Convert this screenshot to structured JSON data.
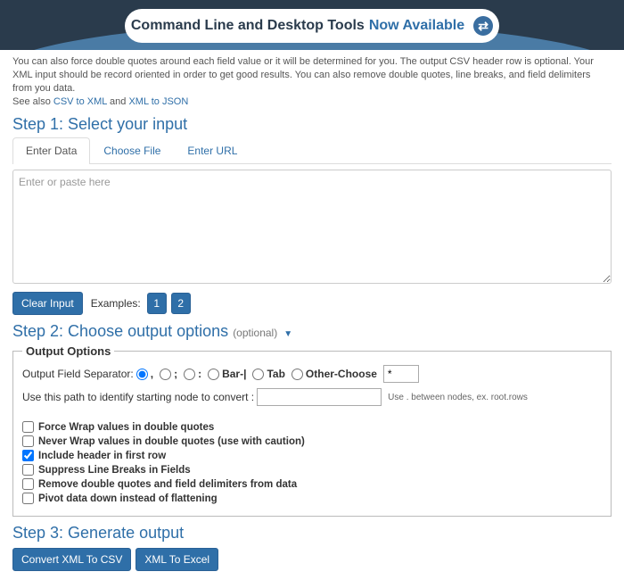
{
  "banner": {
    "title_a": "Command Line and Desktop Tools",
    "title_b": "Now Available",
    "icon_glyph": "⇄"
  },
  "intro": {
    "line1": "You can also force double quotes around each field value or it will be determined for you. The output CSV header row is optional. Your XML input should be record oriented in order to get good results. You can also remove double quotes, line breaks, and field delimiters from you data.",
    "see_also": "See also ",
    "link1": "CSV to XML",
    "and": " and ",
    "link2": "XML to JSON"
  },
  "step1": {
    "title": "Step 1: Select your input",
    "tabs": [
      "Enter Data",
      "Choose File",
      "Enter URL"
    ],
    "placeholder": "Enter or paste here",
    "clear": "Clear Input",
    "examples_label": "Examples:",
    "ex1": "1",
    "ex2": "2"
  },
  "step2": {
    "title": "Step 2: Choose output options ",
    "optional": "(optional)",
    "legend": "Output Options",
    "sep_label": "Output Field Separator:",
    "sep_opts": {
      "comma": ",",
      "semi": ";",
      "colon": ":",
      "bar": "Bar-|",
      "tab": "Tab",
      "other": "Other-Choose"
    },
    "other_val": "*",
    "path_label": "Use this path to identify starting node to convert :",
    "path_hint": "Use . between nodes, ex. root.rows",
    "checks": {
      "force_wrap": "Force Wrap values in double quotes",
      "never_wrap": "Never Wrap values in double quotes (use with caution)",
      "header": "Include header in first row",
      "suppress": "Suppress Line Breaks in Fields",
      "remove": "Remove double quotes and field delimiters from data",
      "pivot": "Pivot data down instead of flattening"
    }
  },
  "step3": {
    "title": "Step 3: Generate output",
    "btn_csv": "Convert XML To CSV",
    "btn_excel": "XML To Excel"
  }
}
